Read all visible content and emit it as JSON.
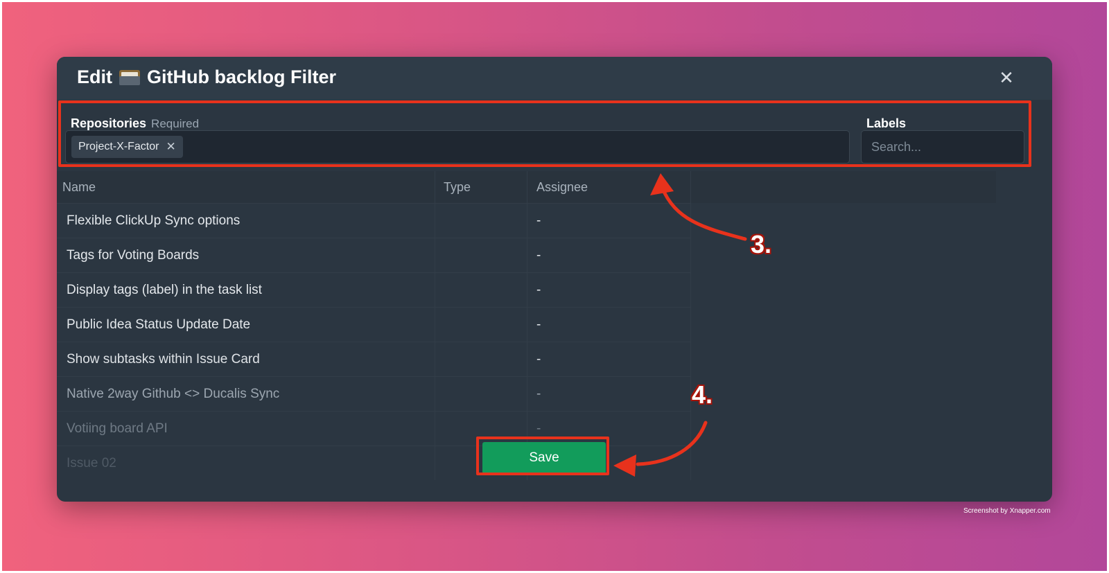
{
  "colors": {
    "annotation_red": "#e8321c",
    "save_green": "#129c5b",
    "modal_bg": "#2b3641"
  },
  "modal": {
    "title_prefix": "Edit",
    "title_icon": "file-cabinet-icon",
    "title_suffix": "GitHub backlog Filter",
    "close_icon": "✕"
  },
  "filters": {
    "repositories_label": "Repositories",
    "repositories_required": "Required",
    "repositories_selected": [
      {
        "label": "Project-X-Factor",
        "remove_icon": "✕"
      }
    ],
    "labels_label": "Labels",
    "labels_placeholder": "Search..."
  },
  "table": {
    "columns": [
      "Name",
      "Type",
      "Assignee"
    ],
    "rows": [
      {
        "name": "Flexible ClickUp Sync options",
        "type": "",
        "assignee": "-"
      },
      {
        "name": "Tags for Voting Boards",
        "type": "",
        "assignee": "-"
      },
      {
        "name": "Display tags (label) in the task list",
        "type": "",
        "assignee": "-"
      },
      {
        "name": "Public Idea Status Update Date",
        "type": "",
        "assignee": "-"
      },
      {
        "name": "Show subtasks within Issue Card",
        "type": "",
        "assignee": "-"
      },
      {
        "name": "Native 2way Github <> Ducalis Sync",
        "type": "",
        "assignee": "-"
      },
      {
        "name": "Votiing board API",
        "type": "",
        "assignee": "-"
      },
      {
        "name": "Issue 02",
        "type": "",
        "assignee": ""
      }
    ]
  },
  "save_label": "Save",
  "annotations": {
    "step3": "3.",
    "step4": "4."
  },
  "credit": "Screenshot by Xnapper.com"
}
